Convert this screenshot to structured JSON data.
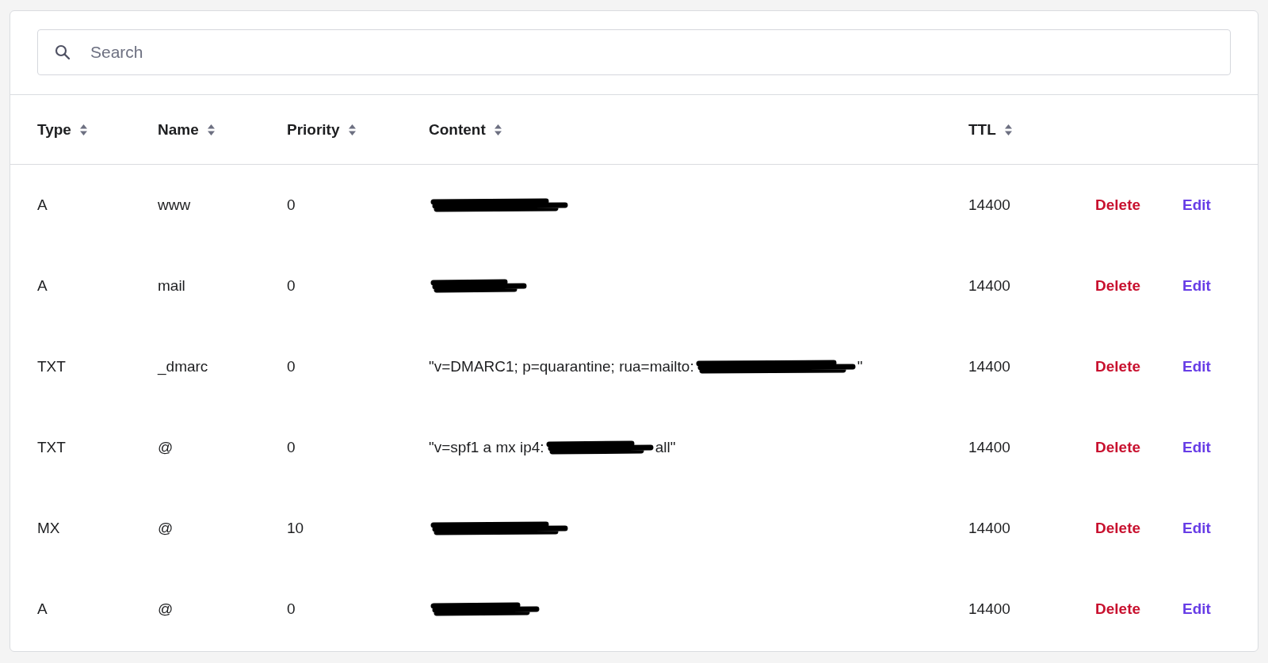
{
  "search": {
    "placeholder": "Search"
  },
  "table": {
    "columns": [
      {
        "label": "Type",
        "sortable": true
      },
      {
        "label": "Name",
        "sortable": true
      },
      {
        "label": "Priority",
        "sortable": true
      },
      {
        "label": "Content",
        "sortable": true
      },
      {
        "label": "TTL",
        "sortable": true
      }
    ],
    "rows": [
      {
        "type": "A",
        "name": "www",
        "priority": "0",
        "content": [
          {
            "kind": "redaction"
          }
        ],
        "ttl": "14400",
        "actions": [
          "Delete",
          "Edit"
        ]
      },
      {
        "type": "A",
        "name": "mail",
        "priority": "0",
        "content": [
          {
            "kind": "redaction"
          }
        ],
        "ttl": "14400",
        "actions": [
          "Delete",
          "Edit"
        ]
      },
      {
        "type": "TXT",
        "name": "_dmarc",
        "priority": "0",
        "content": [
          {
            "kind": "text",
            "text": "\"v=DMARC1; p=quarantine; rua=mailto:"
          },
          {
            "kind": "redaction"
          },
          {
            "kind": "text",
            "text": "\""
          }
        ],
        "ttl": "14400",
        "actions": [
          "Delete",
          "Edit"
        ]
      },
      {
        "type": "TXT",
        "name": "@",
        "priority": "0",
        "content": [
          {
            "kind": "text",
            "text": "\"v=spf1 a mx ip4:"
          },
          {
            "kind": "redaction"
          },
          {
            "kind": "text",
            "text": "all\""
          }
        ],
        "ttl": "14400",
        "actions": [
          "Delete",
          "Edit"
        ]
      },
      {
        "type": "MX",
        "name": "@",
        "priority": "10",
        "content": [
          {
            "kind": "redaction"
          }
        ],
        "ttl": "14400",
        "actions": [
          "Delete",
          "Edit"
        ]
      },
      {
        "type": "A",
        "name": "@",
        "priority": "0",
        "content": [
          {
            "kind": "redaction"
          }
        ],
        "ttl": "14400",
        "actions": [
          "Delete",
          "Edit"
        ]
      }
    ]
  }
}
